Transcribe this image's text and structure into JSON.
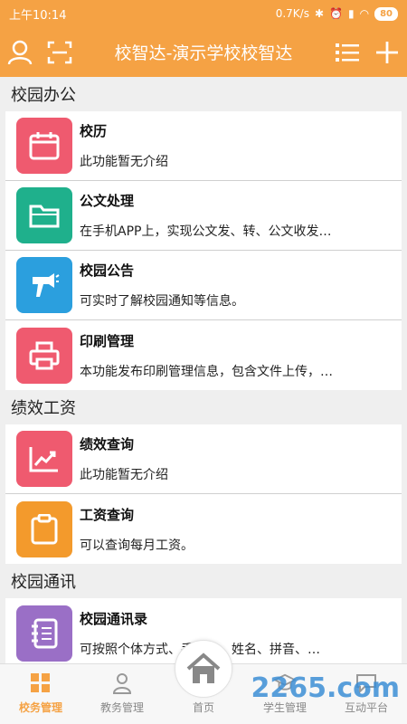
{
  "status": {
    "time": "上午10:14",
    "speed": "0.7K/s",
    "battery": "80"
  },
  "header": {
    "title": "校智达-演示学校校智达"
  },
  "sections": [
    {
      "title": "校园办公",
      "items": [
        {
          "title": "校历",
          "desc": "此功能暂无介绍",
          "icon": "calendar-icon",
          "color": "#ef5a6f"
        },
        {
          "title": "公文处理",
          "desc": "在手机APP上，实现公文发、转、公文收发…",
          "icon": "folder-icon",
          "color": "#1fb08c"
        },
        {
          "title": "校园公告",
          "desc": "可实时了解校园通知等信息。",
          "icon": "megaphone-icon",
          "color": "#2b9fde"
        },
        {
          "title": "印刷管理",
          "desc": "本功能发布印刷管理信息，包含文件上传，…",
          "icon": "printer-icon",
          "color": "#ef5a6f"
        }
      ]
    },
    {
      "title": "绩效工资",
      "items": [
        {
          "title": "绩效查询",
          "desc": "此功能暂无介绍",
          "icon": "chart-icon",
          "color": "#ef5a6f"
        },
        {
          "title": "工资查询",
          "desc": "可以查询每月工资。",
          "icon": "clipboard-icon",
          "color": "#f39a2c"
        }
      ]
    },
    {
      "title": "校园通讯",
      "items": [
        {
          "title": "校园通讯录",
          "desc": "可按照个体方式、手机号、姓名、拼音、…",
          "icon": "addressbook-icon",
          "color": "#9a6fc6"
        }
      ]
    }
  ],
  "tabs": [
    {
      "label": "校务管理",
      "icon": "grid-icon",
      "active": true
    },
    {
      "label": "教务管理",
      "icon": "person-icon",
      "active": false
    },
    {
      "label": "首页",
      "icon": "home-icon",
      "active": false
    },
    {
      "label": "学生管理",
      "icon": "graduation-cap-icon",
      "active": false
    },
    {
      "label": "互动平台",
      "icon": "chat-icon",
      "active": false
    }
  ],
  "watermark": "2265.com"
}
